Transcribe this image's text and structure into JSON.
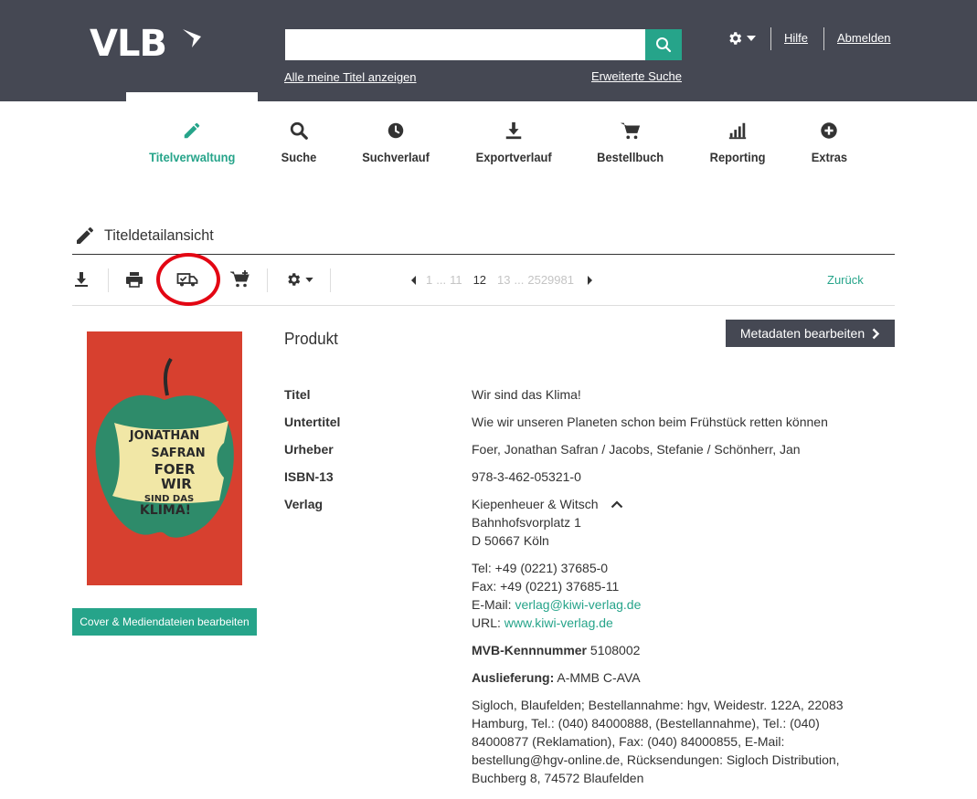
{
  "header": {
    "logo": "VLB",
    "search_placeholder": "",
    "all_titles_link": "Alle meine Titel anzeigen",
    "advanced_search_link": "Erweiterte Suche",
    "help_link": "Hilfe",
    "logout_link": "Abmelden"
  },
  "nav": [
    {
      "label": "Titelverwaltung",
      "icon": "pencil-icon",
      "active": true
    },
    {
      "label": "Suche",
      "icon": "search-icon",
      "active": false
    },
    {
      "label": "Suchverlauf",
      "icon": "clock-icon",
      "active": false
    },
    {
      "label": "Exportverlauf",
      "icon": "download-icon",
      "active": false
    },
    {
      "label": "Bestellbuch",
      "icon": "cart-icon",
      "active": false
    },
    {
      "label": "Reporting",
      "icon": "bar-chart-icon",
      "active": false
    },
    {
      "label": "Extras",
      "icon": "plus-circle-icon",
      "active": false
    }
  ],
  "page": {
    "title": "Titeldetailansicht"
  },
  "toolbar": {
    "icons": [
      "download-icon",
      "print-icon",
      "truck-check-icon",
      "cart-add-icon",
      "gear-icon"
    ],
    "pager": {
      "first": "1",
      "dots1": "...",
      "prev": "11",
      "current": "12",
      "next": "13",
      "dots2": "...",
      "last": "2529981"
    },
    "back_label": "Zurück"
  },
  "cover": {
    "author": "JONATHAN SAFRAN FOER",
    "title": "WIR SIND DAS KLIMA!",
    "edit_button": "Cover & Mediendateien bearbeiten"
  },
  "product": {
    "section_title": "Produkt",
    "edit_metadata_button": "Metadaten bearbeiten",
    "fields": {
      "titel_label": "Titel",
      "titel": "Wir sind das Klima!",
      "untertitel_label": "Untertitel",
      "untertitel": "Wie wir unseren Planeten schon beim Frühstück retten können",
      "urheber_label": "Urheber",
      "urheber": "Foer, Jonathan Safran / Jacobs, Stefanie / Schönherr, Jan",
      "isbn_label": "ISBN-13",
      "isbn": "978-3-462-05321-0",
      "verlag_label": "Verlag"
    },
    "publisher": {
      "name": "Kiepenheuer & Witsch",
      "street": "Bahnhofsvorplatz 1",
      "city": "D 50667 Köln",
      "tel": "Tel: +49 (0221) 37685-0",
      "fax": "Fax: +49 (0221) 37685-11",
      "email_label": "E-Mail:",
      "email": "verlag@kiwi-verlag.de",
      "url_label": "URL:",
      "url": "www.kiwi-verlag.de",
      "mvb_label": "MVB-Kennnummer",
      "mvb": "5108002",
      "auslieferung_label": "Auslieferung:",
      "auslieferung": "A-MMB C-AVA",
      "delivery_lines": [
        "Sigloch, Blaufelden; Bestellannahme: hgv, Weidestr. 122A, 22083",
        "Hamburg, Tel.: (040) 84000888, (Bestellannahme), Tel.: (040)",
        "84000877 (Reklamation), Fax: (040) 84000855, E-Mail:",
        "bestellung@hgv-online.de, Rücksendungen: Sigloch Distribution,",
        "Buchberg 8, 74572 Blaufelden"
      ]
    }
  },
  "colors": {
    "header_bg": "#454853",
    "accent": "#26a48a",
    "highlight_circle": "#e30613"
  }
}
